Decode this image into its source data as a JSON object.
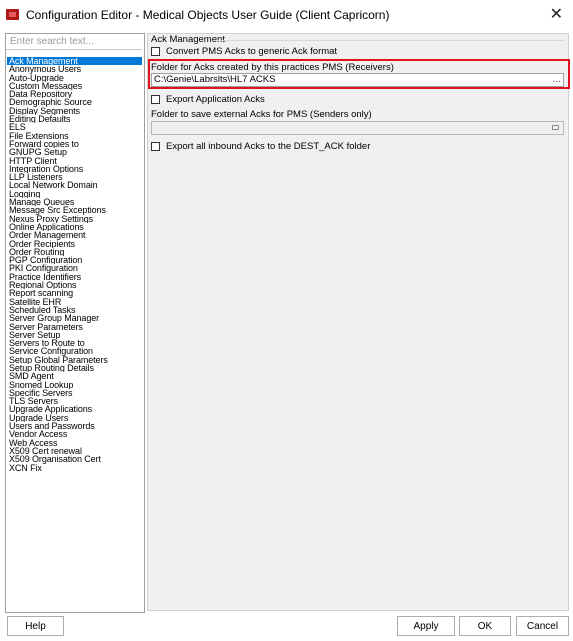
{
  "window": {
    "title": "Configuration Editor - Medical Objects User Guide (Client Capricorn)",
    "close_glyph": "✕",
    "app_icon": "app-logo-icon"
  },
  "search": {
    "placeholder": "Enter search text..."
  },
  "nav": {
    "selected": "Ack Management",
    "items": [
      "Ack Management",
      "Anonymous Users",
      "Auto-Upgrade",
      "Custom Messages",
      "Data Repository",
      "Demographic Source",
      "Display Segments",
      "Editing Defaults",
      "ELS",
      "File Extensions",
      "Forward copies to",
      "GNUPG Setup",
      "HTTP Client",
      "Integration Options",
      "LLP Listeners",
      "Local Network Domain",
      "Logging",
      "Manage Queues",
      "Message Src Exceptions",
      "Nexus Proxy Settings",
      "Online Applications",
      "Order Management",
      "Order Recipients",
      "Order Routing",
      "PGP Configuration",
      "PKI Configuration",
      "Practice Identifiers",
      "Regional Options",
      "Report scanning",
      "Satellite EHR",
      "Scheduled Tasks",
      "Server Group Manager",
      "Server Parameters",
      "Server Setup",
      "Servers to Route to",
      "Service Configuration",
      "Setup Global Parameters",
      "Setup Routing Details",
      "SMD Agent",
      "Snomed Lookup",
      "Specific Servers",
      "TLS Servers",
      "Upgrade Applications",
      "Upgrade Users",
      "Users and Passwords",
      "Vendor Access",
      "Web Access",
      "X509 Cert renewal",
      "X509 Organisation Cert",
      "XCN Fix"
    ]
  },
  "panel": {
    "group_title": "Ack Management",
    "convert_label": "Convert PMS Acks to generic Ack format",
    "convert_checked": false,
    "folder_receivers_label": "Folder for Acks created by this practices PMS (Receivers)",
    "folder_receivers_value": "C:\\Genie\\Labrslts\\HL7 ACKS",
    "browse_glyph": "...",
    "export_app_label": "Export Application Acks",
    "export_app_checked": false,
    "folder_senders_label": "Folder to save external Acks for PMS (Senders only)",
    "folder_senders_value": "",
    "export_inbound_label": "Export all inbound Acks to the DEST_ACK folder",
    "export_inbound_checked": false,
    "highlight_color": "#e0141e"
  },
  "buttons": {
    "help": "Help",
    "apply": "Apply",
    "ok": "OK",
    "cancel": "Cancel"
  }
}
